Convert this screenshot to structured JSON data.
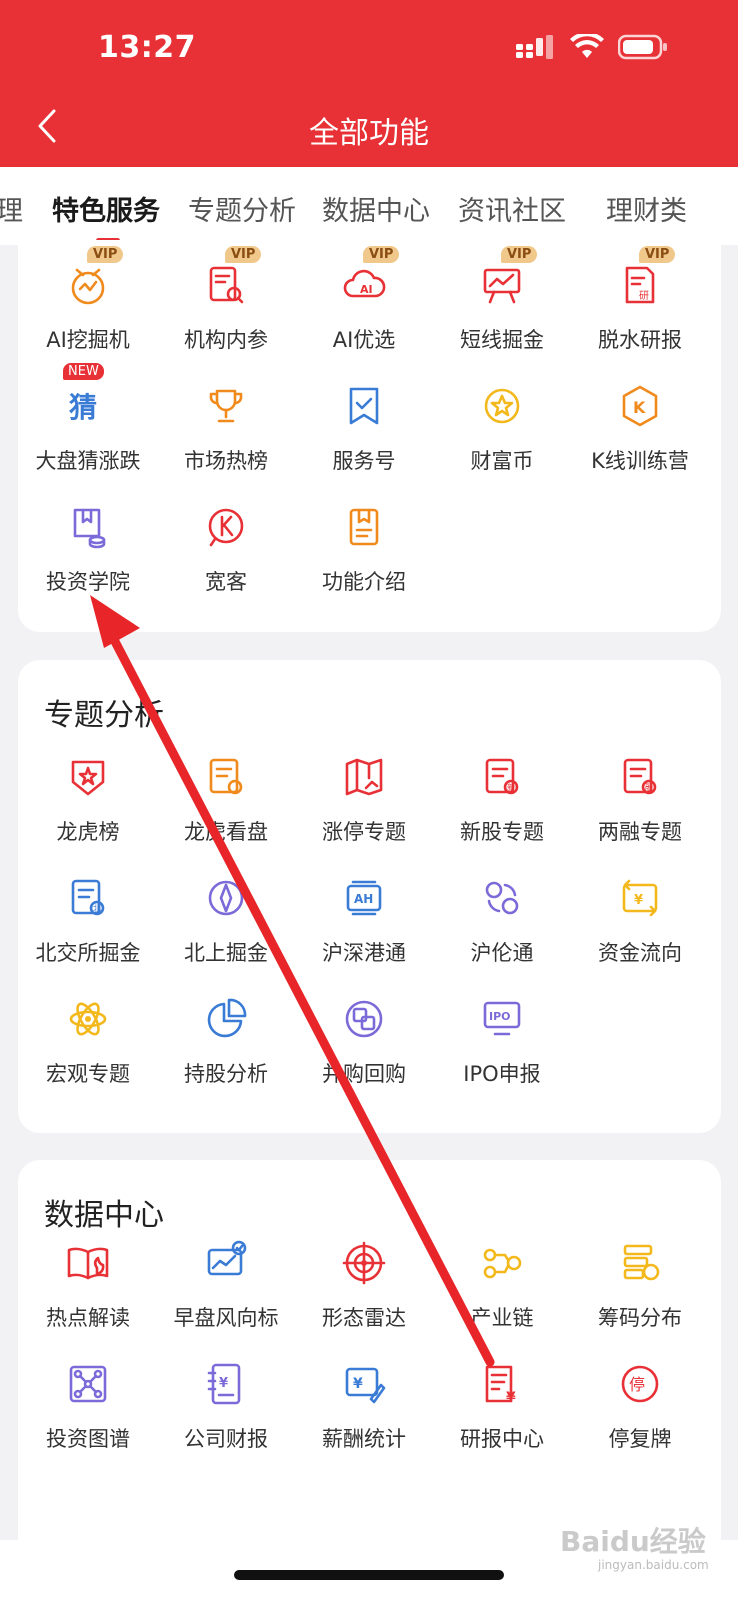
{
  "status_bar": {
    "time": "13:27"
  },
  "header": {
    "title": "全部功能"
  },
  "tabs": [
    {
      "label": "理"
    },
    {
      "label": "特色服务"
    },
    {
      "label": "专题分析"
    },
    {
      "label": "数据中心"
    },
    {
      "label": "资讯社区"
    },
    {
      "label": "理财类"
    }
  ],
  "featured": {
    "items": [
      {
        "label": "AI挖掘机",
        "badge": "VIP",
        "icon": "ai-dig-icon",
        "color": "#f08a1c"
      },
      {
        "label": "机构内参",
        "badge": "VIP",
        "icon": "institution-report-icon",
        "color": "#e83136"
      },
      {
        "label": "AI优选",
        "badge": "VIP",
        "icon": "ai-cloud-icon",
        "color": "#e83136"
      },
      {
        "label": "短线掘金",
        "badge": "VIP",
        "icon": "shortline-chart-icon",
        "color": "#e83136"
      },
      {
        "label": "脱水研报",
        "badge": "VIP",
        "icon": "research-doc-icon",
        "color": "#e83136"
      },
      {
        "label": "大盘猜涨跌",
        "badge": "NEW",
        "icon": "guess-icon",
        "color": "#3a7bd5"
      },
      {
        "label": "市场热榜",
        "badge": "",
        "icon": "trophy-icon",
        "color": "#f08a1c"
      },
      {
        "label": "服务号",
        "badge": "",
        "icon": "bookmark-check-icon",
        "color": "#3a7bd5"
      },
      {
        "label": "财富币",
        "badge": "",
        "icon": "coin-star-icon",
        "color": "#f2b81c"
      },
      {
        "label": "K线训练营",
        "badge": "",
        "icon": "kline-hex-icon",
        "color": "#f08a1c"
      },
      {
        "label": "投资学院",
        "badge": "",
        "icon": "academy-book-icon",
        "color": "#7b6bd8"
      },
      {
        "label": "宽客",
        "badge": "",
        "icon": "quant-k-icon",
        "color": "#e83136"
      },
      {
        "label": "功能介绍",
        "badge": "",
        "icon": "function-intro-icon",
        "color": "#f08a1c"
      }
    ]
  },
  "topic_analysis": {
    "title": "专题分析",
    "items": [
      {
        "label": "龙虎榜",
        "icon": "dragon-tiger-icon",
        "color": "#e83136"
      },
      {
        "label": "龙虎看盘",
        "icon": "dragon-watch-icon",
        "color": "#f08a1c"
      },
      {
        "label": "涨停专题",
        "icon": "limit-up-map-icon",
        "color": "#e83136"
      },
      {
        "label": "新股专题",
        "icon": "new-stock-icon",
        "color": "#e83136"
      },
      {
        "label": "两融专题",
        "icon": "margin-icon",
        "color": "#e83136"
      },
      {
        "label": "北交所掘金",
        "icon": "bse-icon",
        "color": "#3a7bd5"
      },
      {
        "label": "北上掘金",
        "icon": "compass-icon",
        "color": "#7b6bd8"
      },
      {
        "label": "沪深港通",
        "icon": "ah-connect-icon",
        "color": "#3a7bd5"
      },
      {
        "label": "沪伦通",
        "icon": "sh-london-icon",
        "color": "#7b6bd8"
      },
      {
        "label": "资金流向",
        "icon": "fund-flow-icon",
        "color": "#f2b81c"
      },
      {
        "label": "宏观专题",
        "icon": "macro-atom-icon",
        "color": "#f2b81c"
      },
      {
        "label": "持股分析",
        "icon": "pie-chart-icon",
        "color": "#3a7bd5"
      },
      {
        "label": "并购回购",
        "icon": "merger-icon",
        "color": "#7b6bd8"
      },
      {
        "label": "IPO申报",
        "icon": "ipo-icon",
        "color": "#7b6bd8"
      }
    ]
  },
  "data_center": {
    "title": "数据中心",
    "items": [
      {
        "label": "热点解读",
        "icon": "hot-book-icon",
        "color": "#e83136"
      },
      {
        "label": "早盘风向标",
        "icon": "morning-chart-icon",
        "color": "#3a7bd5"
      },
      {
        "label": "形态雷达",
        "icon": "radar-icon",
        "color": "#e83136"
      },
      {
        "label": "产业链",
        "icon": "chain-icon",
        "color": "#f2b81c"
      },
      {
        "label": "筹码分布",
        "icon": "chips-icon",
        "color": "#f2b81c"
      },
      {
        "label": "投资图谱",
        "icon": "graph-icon",
        "color": "#7b6bd8"
      },
      {
        "label": "公司财报",
        "icon": "financial-report-icon",
        "color": "#7b6bd8"
      },
      {
        "label": "薪酬统计",
        "icon": "salary-icon",
        "color": "#3a7bd5"
      },
      {
        "label": "研报中心",
        "icon": "research-center-icon",
        "color": "#e83136"
      },
      {
        "label": "停复牌",
        "icon": "suspension-icon",
        "color": "#e83136"
      }
    ]
  },
  "watermark": {
    "text": "Baidu经验",
    "sub": "jingyan.baidu.com"
  },
  "annotation": {
    "color": "#e8262a"
  }
}
